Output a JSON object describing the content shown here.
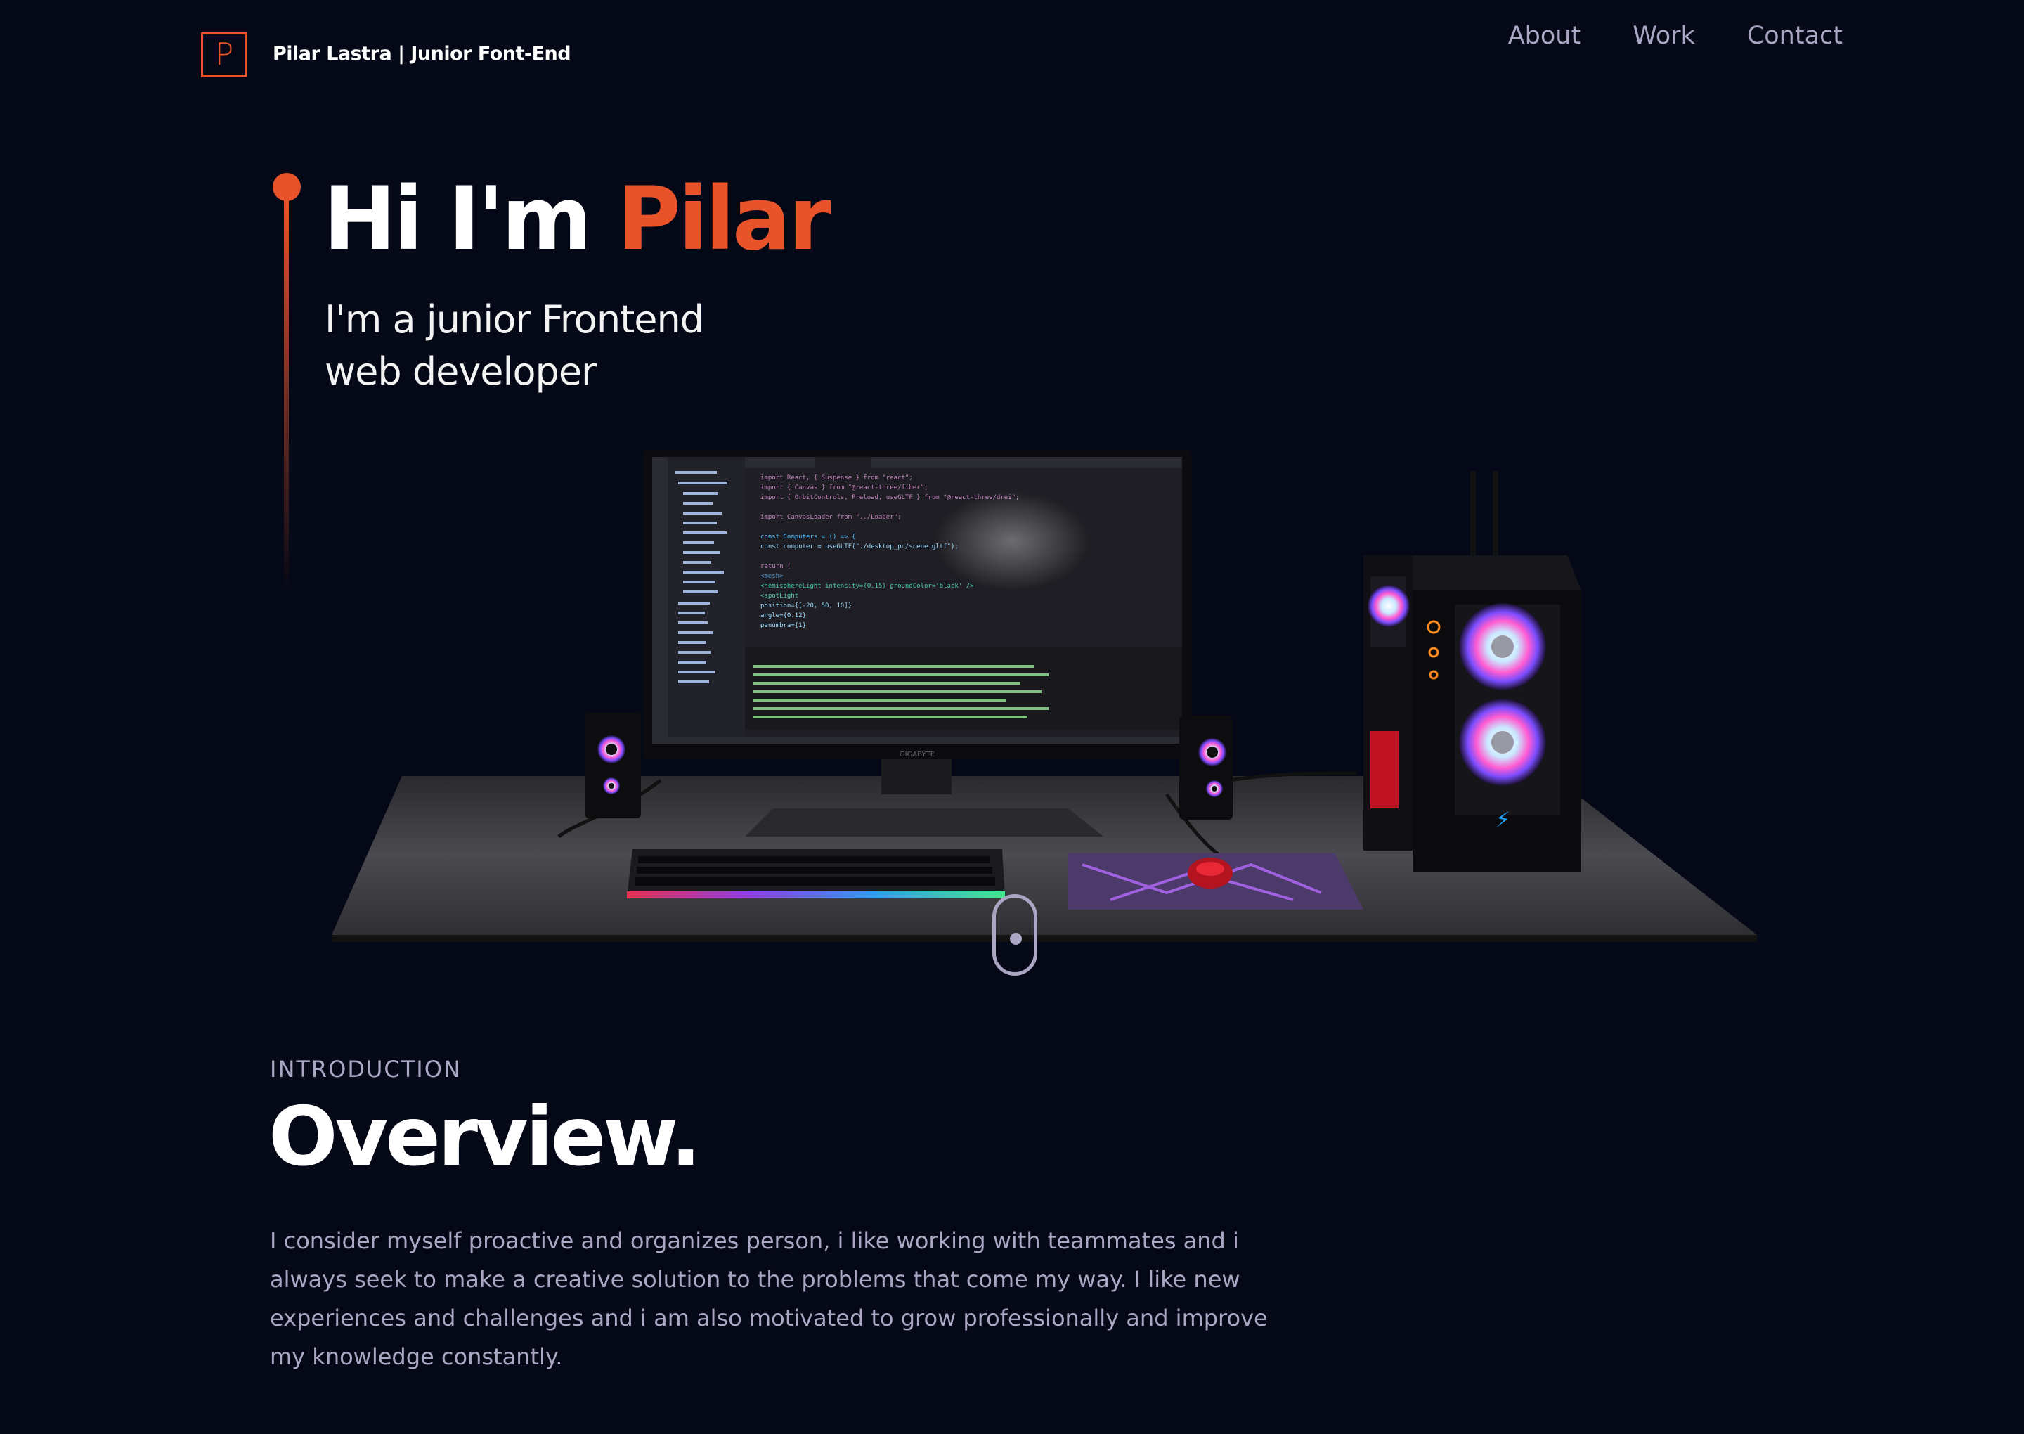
{
  "nav": {
    "logo_letter": "P",
    "brand": "Pilar Lastra | Junior  Font-End",
    "links": [
      "About",
      "Work",
      "Contact"
    ]
  },
  "hero": {
    "greeting": "Hi I'm ",
    "name": "Pilar",
    "subtitle_line1": "I'm a junior Frontend",
    "subtitle_line2": "web developer"
  },
  "scene": {
    "monitor_brand": "GIGABYTE",
    "code_lines": [
      "import React, { Suspense } from \"react\";",
      "import { Canvas } from \"@react-three/fiber\";",
      "import { OrbitControls, Preload, useGLTF } from \"@react-three/drei\";",
      "",
      "import CanvasLoader from \"../Loader\";",
      "",
      "const Computers = () => {",
      "  const computer = useGLTF(\"./desktop_pc/scene.gltf\");",
      "",
      "  return (",
      "    <mesh>",
      "      <hemisphereLight intensity={0.15} groundColor='black' />",
      "      <spotLight",
      "        position={[-20, 50, 10]}",
      "        angle={0.12}",
      "        penumbra={1}"
    ]
  },
  "overview": {
    "label": "INTRODUCTION",
    "title": "Overview.",
    "text": "I consider myself proactive and organizes person, i like working with teammates and i always seek to make a creative solution to the problems that come my way. I like new experiences and challenges and i am also motivated to grow professionally and improve my knowledge constantly."
  },
  "colors": {
    "background": "#050816",
    "accent": "#e8532a",
    "secondary": "#aaa6c3"
  }
}
